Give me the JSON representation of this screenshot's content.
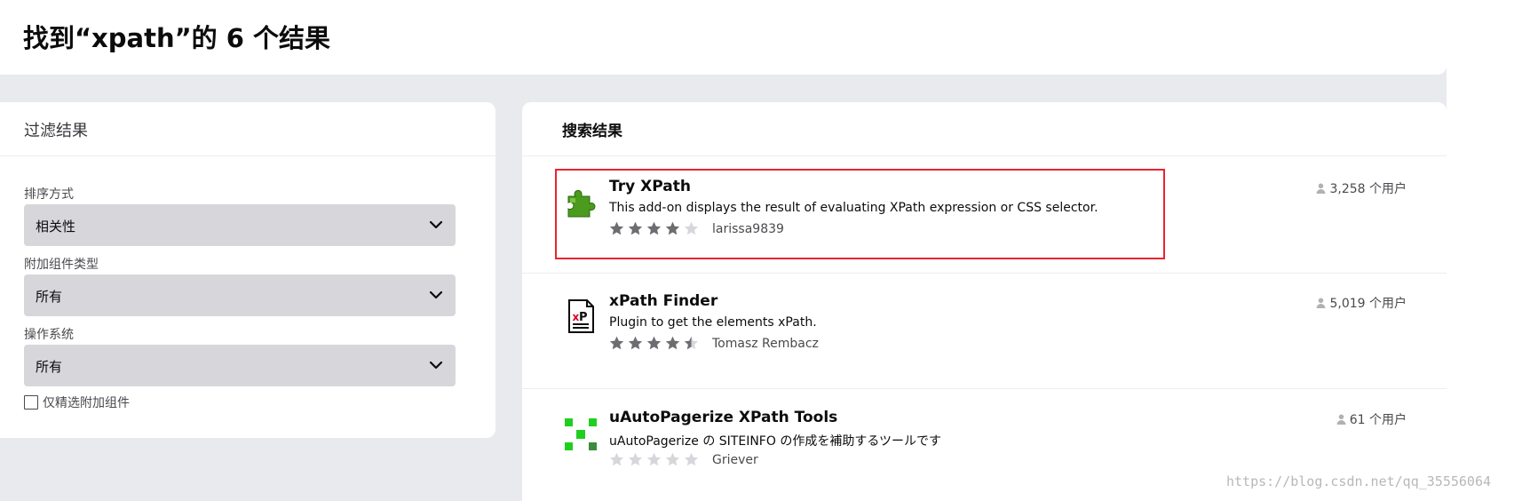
{
  "page": {
    "title": "找到“xpath”的 6 个结果"
  },
  "filter": {
    "heading": "过滤结果",
    "sort_label": "排序方式",
    "sort_value": "相关性",
    "type_label": "附加组件类型",
    "type_value": "所有",
    "os_label": "操作系统",
    "os_value": "所有",
    "recommended_label": "仅精选附加组件",
    "recommended_checked": false
  },
  "results": {
    "heading": "搜索结果",
    "items": [
      {
        "name": "Try XPath",
        "summary": "This add-on displays the result of evaluating XPath expression or CSS selector.",
        "author": "larissa9839",
        "rating": 4,
        "users": "3,258 个用户",
        "icon": "green-puzzle-icon",
        "highlighted": true
      },
      {
        "name": "xPath Finder",
        "summary": "Plugin to get the elements xPath.",
        "author": "Tomasz Rembacz",
        "rating": 4.5,
        "users": "5,019 个用户",
        "icon": "xpath-document-icon",
        "highlighted": false
      },
      {
        "name": "uAutoPagerize XPath Tools",
        "summary": "uAutoPagerize の SITEINFO の作成を補助するツールです",
        "author": "Griever",
        "rating": 0,
        "users": "61 个用户",
        "icon": "green-squares-icon",
        "highlighted": false
      }
    ]
  },
  "watermark": "https://blog.csdn.net/qq_35556064",
  "colors": {
    "star_filled": "#6d6d71",
    "star_empty": "#d7d7db",
    "highlight": "#e8252e",
    "select_bg": "#d7d7db"
  }
}
